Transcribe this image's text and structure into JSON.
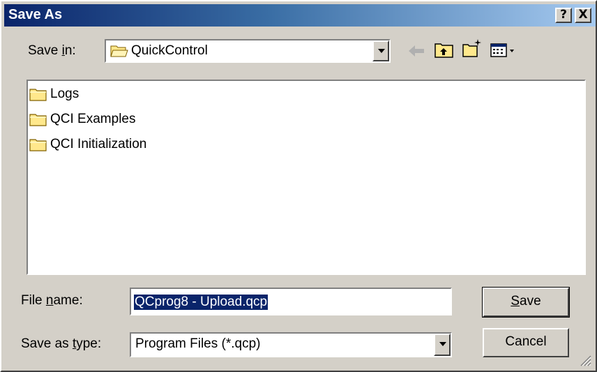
{
  "window": {
    "title": "Save As"
  },
  "caption_buttons": {
    "help": "?",
    "close": "X"
  },
  "save_in": {
    "label_pre": "Save ",
    "label_key": "i",
    "label_post": "n:",
    "value": "QuickControl"
  },
  "toolbar": {
    "icons": [
      "back-arrow-icon",
      "up-folder-icon",
      "new-folder-icon",
      "view-menu-icon"
    ]
  },
  "files": [
    {
      "name": "Logs"
    },
    {
      "name": "QCI Examples"
    },
    {
      "name": "QCI Initialization"
    }
  ],
  "file_name": {
    "label_pre": "File ",
    "label_key": "n",
    "label_post": "ame:",
    "value": "QCprog8 - Upload.qcp"
  },
  "save_type": {
    "label_pre": "Save as ",
    "label_key": "t",
    "label_post": "ype:",
    "value": "Program Files (*.qcp)"
  },
  "buttons": {
    "save_key": "S",
    "save_rest": "ave",
    "cancel": "Cancel"
  },
  "colors": {
    "face": "#d4d0c8",
    "title_start": "#0a246a",
    "title_end": "#a6caf0",
    "selection": "#0a246a",
    "folder": "#ffe88c"
  }
}
